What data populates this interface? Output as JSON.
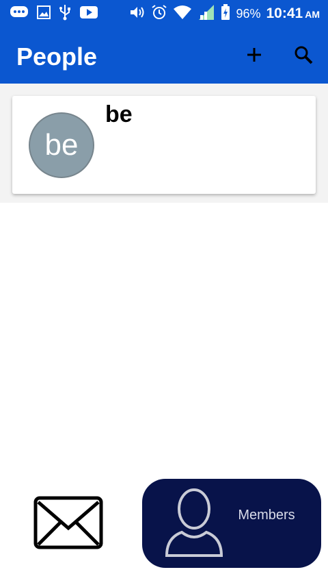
{
  "statusbar": {
    "battery_percent": "96%",
    "time": "10:41",
    "ampm": "AM",
    "icons": [
      "chat-icon",
      "image-icon",
      "usb-icon",
      "youtube-icon",
      "volume-icon",
      "alarm-icon",
      "wifi-icon",
      "signal-icon",
      "battery-icon"
    ]
  },
  "appbar": {
    "title": "People",
    "add_icon": "add-icon",
    "search_icon": "search-icon"
  },
  "people": [
    {
      "initials": "be",
      "name": "be"
    }
  ],
  "bottom": {
    "mail_icon": "mail-icon",
    "members_label": "Members",
    "members_icon": "person-icon"
  },
  "colors": {
    "primary": "#0b57d0",
    "avatar": "#8a9ea9",
    "members_bg": "#08134a"
  }
}
